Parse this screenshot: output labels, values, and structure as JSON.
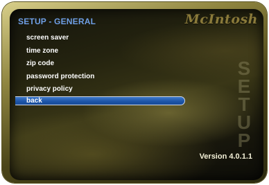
{
  "header": {
    "title": "SETUP - GENERAL",
    "brand": "McIntosh"
  },
  "menu": {
    "items": [
      {
        "label": "screen saver"
      },
      {
        "label": "time zone"
      },
      {
        "label": "zip code"
      },
      {
        "label": "password protection"
      },
      {
        "label": "privacy policy"
      },
      {
        "label": "back",
        "selected": true
      }
    ]
  },
  "watermark": {
    "text": "SETUP",
    "letters": [
      "S",
      "E",
      "T",
      "U",
      "P"
    ]
  },
  "footer": {
    "version": "Version 4.0.1.1"
  },
  "colors": {
    "title": "#6f9fe6",
    "selection": "#1c54a8",
    "menu_text": "#ffffff",
    "frame_gold": "#8f8540"
  }
}
